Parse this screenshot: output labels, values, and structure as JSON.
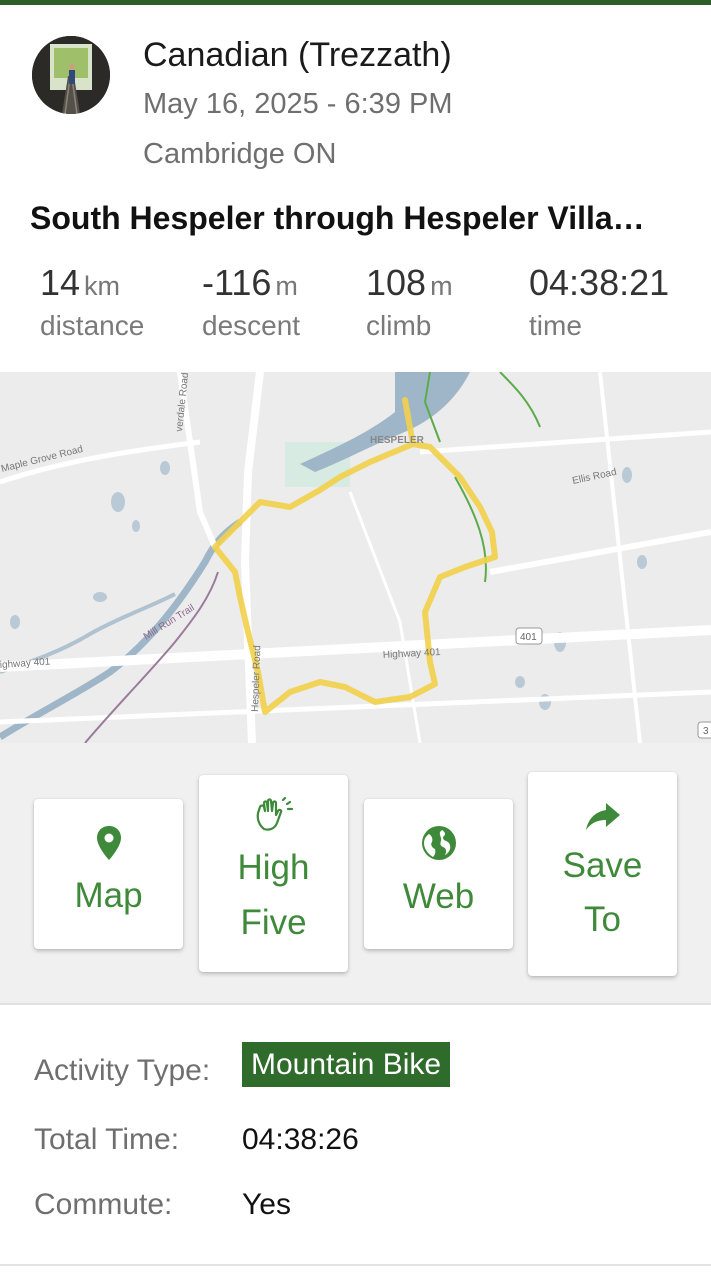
{
  "user": {
    "name": "Canadian (Trezzath)",
    "date": "May 16, 2025 - 6:39 PM",
    "location": "Cambridge ON"
  },
  "activity": {
    "title": "South Hespeler through Hespeler Villa…"
  },
  "stats": [
    {
      "value": "14",
      "unit": "km",
      "label": "distance"
    },
    {
      "value": "-116",
      "unit": "m",
      "label": "descent"
    },
    {
      "value": "108",
      "unit": "m",
      "label": "climb"
    },
    {
      "value": "04:38:21",
      "unit": "",
      "label": "time"
    }
  ],
  "map": {
    "labels": {
      "maple_grove": "Maple Grove Road",
      "riverdale": "verdale Road",
      "hespeler": "HESPELER",
      "ellis": "Ellis Road",
      "mill_run": "Mill Run Trail",
      "highway_left": "ighway 401",
      "highway_right": "Highway 401",
      "hespeler_road": "Hespeler Road",
      "shield_401": "401",
      "shield_3": "3"
    }
  },
  "actions": {
    "map": {
      "label": "Map",
      "icon": "map-pin-icon"
    },
    "high_five": {
      "label_line1": "High",
      "label_line2": "Five",
      "icon": "waving-hand-icon"
    },
    "web": {
      "label": "Web",
      "icon": "globe-icon"
    },
    "save_to": {
      "label_line1": "Save",
      "label_line2": "To",
      "icon": "share-arrow-icon"
    }
  },
  "details": {
    "activity_type_label": "Activity Type:",
    "activity_type_value": "Mountain Bike",
    "total_time_label": "Total Time:",
    "total_time_value": "04:38:26",
    "commute_label": "Commute:",
    "commute_value": "Yes"
  },
  "colors": {
    "accent_green": "#3f8a3a",
    "badge_green": "#2f6b2a",
    "route_yellow": "#f2d04a"
  }
}
